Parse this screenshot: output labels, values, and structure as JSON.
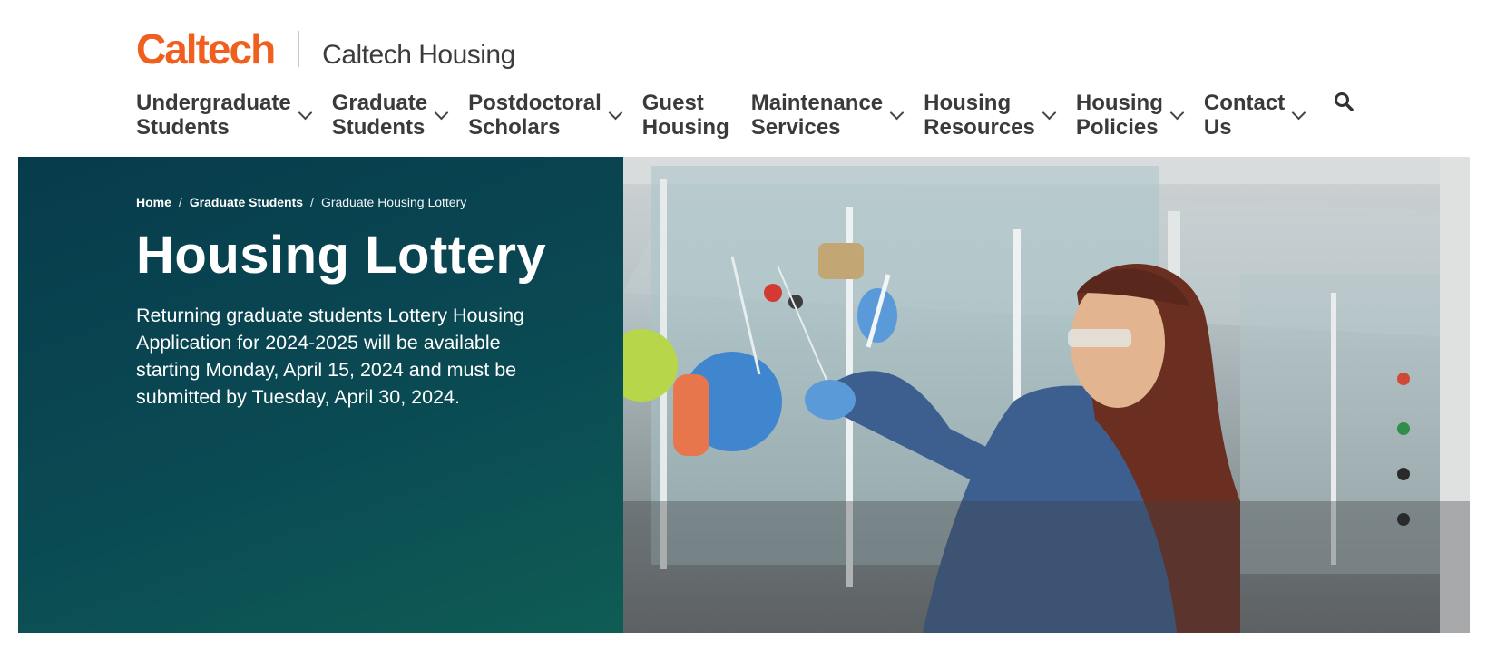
{
  "header": {
    "logo_text": "Caltech",
    "site_name": "Caltech Housing",
    "brand_color": "#f05f1d"
  },
  "nav": {
    "items": [
      {
        "line1": "Undergraduate",
        "line2": "Students",
        "has_dropdown": true
      },
      {
        "line1": "Graduate",
        "line2": "Students",
        "has_dropdown": true
      },
      {
        "line1": "Postdoctoral",
        "line2": "Scholars",
        "has_dropdown": true
      },
      {
        "line1": "Guest",
        "line2": "Housing",
        "has_dropdown": false
      },
      {
        "line1": "Maintenance",
        "line2": "Services",
        "has_dropdown": true
      },
      {
        "line1": "Housing",
        "line2": "Resources",
        "has_dropdown": true
      },
      {
        "line1": "Housing",
        "line2": "Policies",
        "has_dropdown": true
      },
      {
        "line1": "Contact",
        "line2": "Us",
        "has_dropdown": true
      }
    ],
    "search_icon": "search-icon"
  },
  "hero": {
    "breadcrumb": {
      "home": "Home",
      "section": "Graduate Students",
      "current": "Graduate Housing Lottery"
    },
    "title": "Housing Lottery",
    "description": "Returning graduate students Lottery Housing Application for 2024-2025 will be available starting Monday, April 15, 2024 and must be submitted by Tuesday, April 30, 2024.",
    "panel_color": "#073b4c"
  }
}
